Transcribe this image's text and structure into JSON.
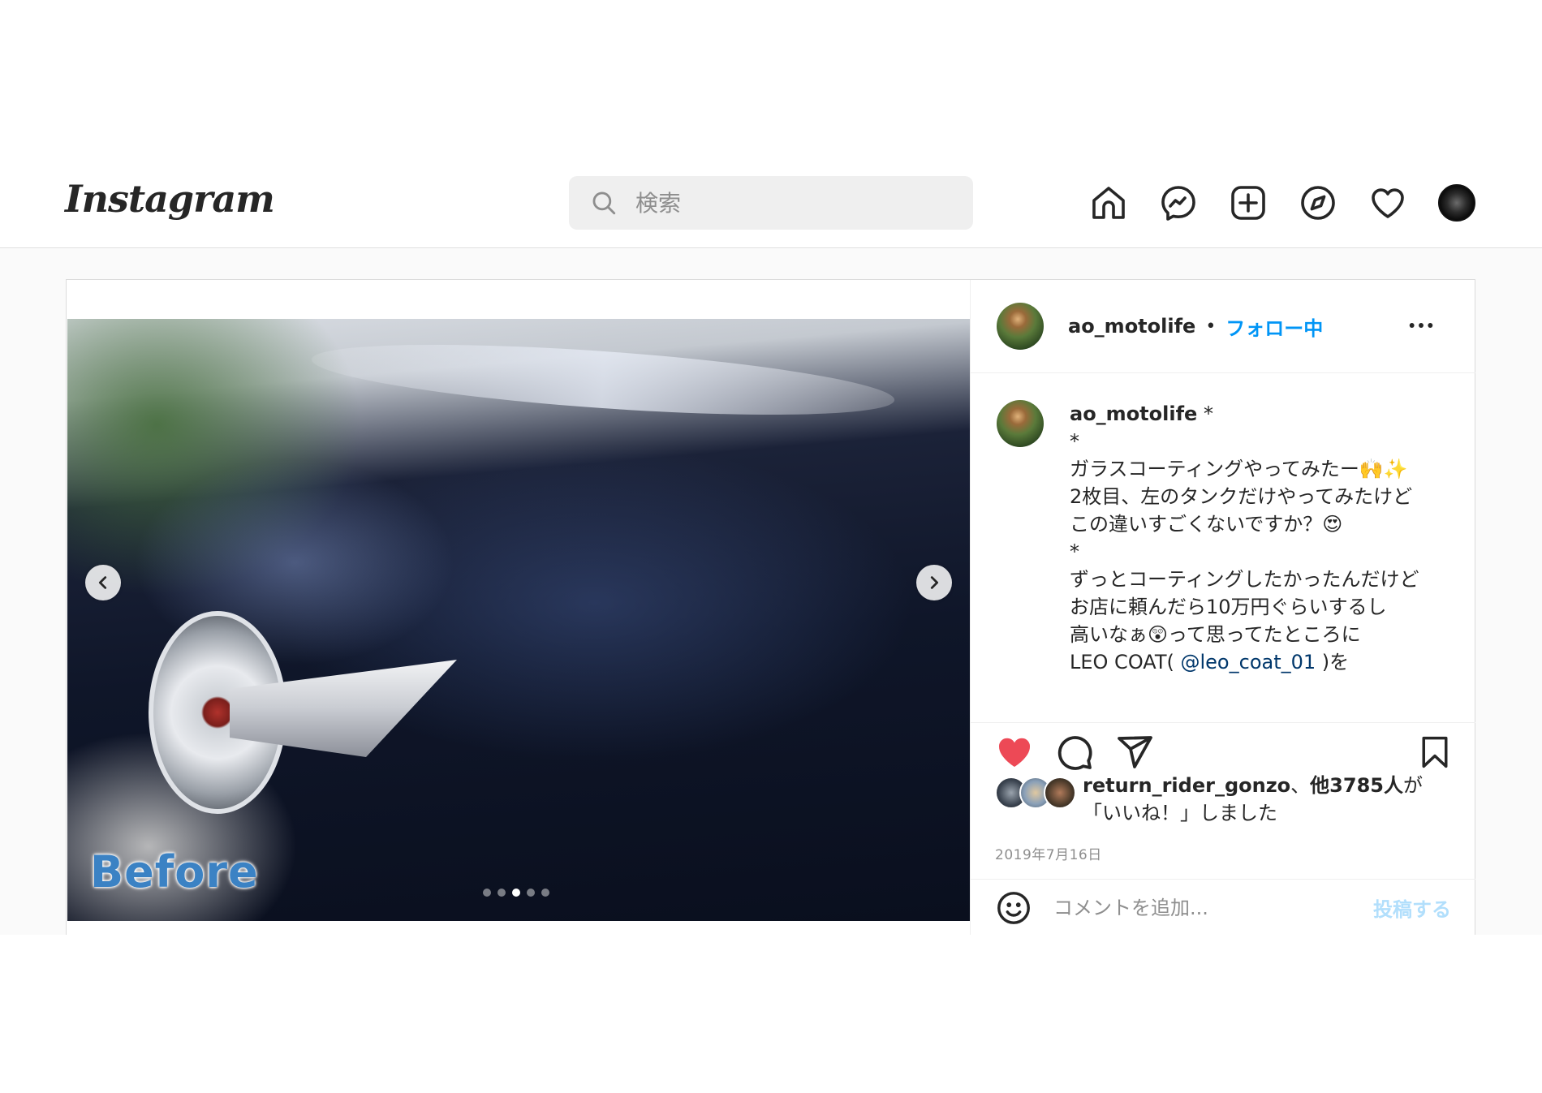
{
  "header": {
    "logo": "Instagram",
    "search": {
      "placeholder": "検索",
      "value": ""
    },
    "nav_icons": [
      "home-icon",
      "messenger-icon",
      "new-post-icon",
      "explore-icon",
      "activity-icon",
      "profile-avatar"
    ]
  },
  "post": {
    "media": {
      "overlay_text": "Before",
      "dot_count": 5,
      "active_dot_index": 2
    },
    "header": {
      "username": "ao_motolife",
      "separator": "•",
      "follow_label": "フォロー中"
    },
    "caption": {
      "username": "ao_motolife",
      "lines": [
        "*",
        "*",
        "ガラスコーティングやってみたー🙌✨",
        "2枚目、左のタンクだけやってみたけど",
        "この違いすごくないですか？😍",
        "*",
        "ずっとコーティングしたかったんだけど",
        "お店に頼んだら10万円ぐらいするし",
        "高いなぁ😲って思ってたところに"
      ],
      "last_line_prefix": "LEO COAT( ",
      "mention": "@leo_coat_01",
      "last_line_suffix": " )を"
    },
    "likes": {
      "user": "return_rider_gonzo",
      "sep": "、",
      "count": "他3785人",
      "rest": "が「いいね！」しました"
    },
    "date": "2019年7月16日",
    "comment": {
      "placeholder": "コメントを追加...",
      "submit_label": "投稿する"
    }
  },
  "colors": {
    "accent": "#0095f6",
    "like": "#ed4956",
    "post_disabled": "#b2dffc",
    "before_text": "#3b82c4"
  }
}
